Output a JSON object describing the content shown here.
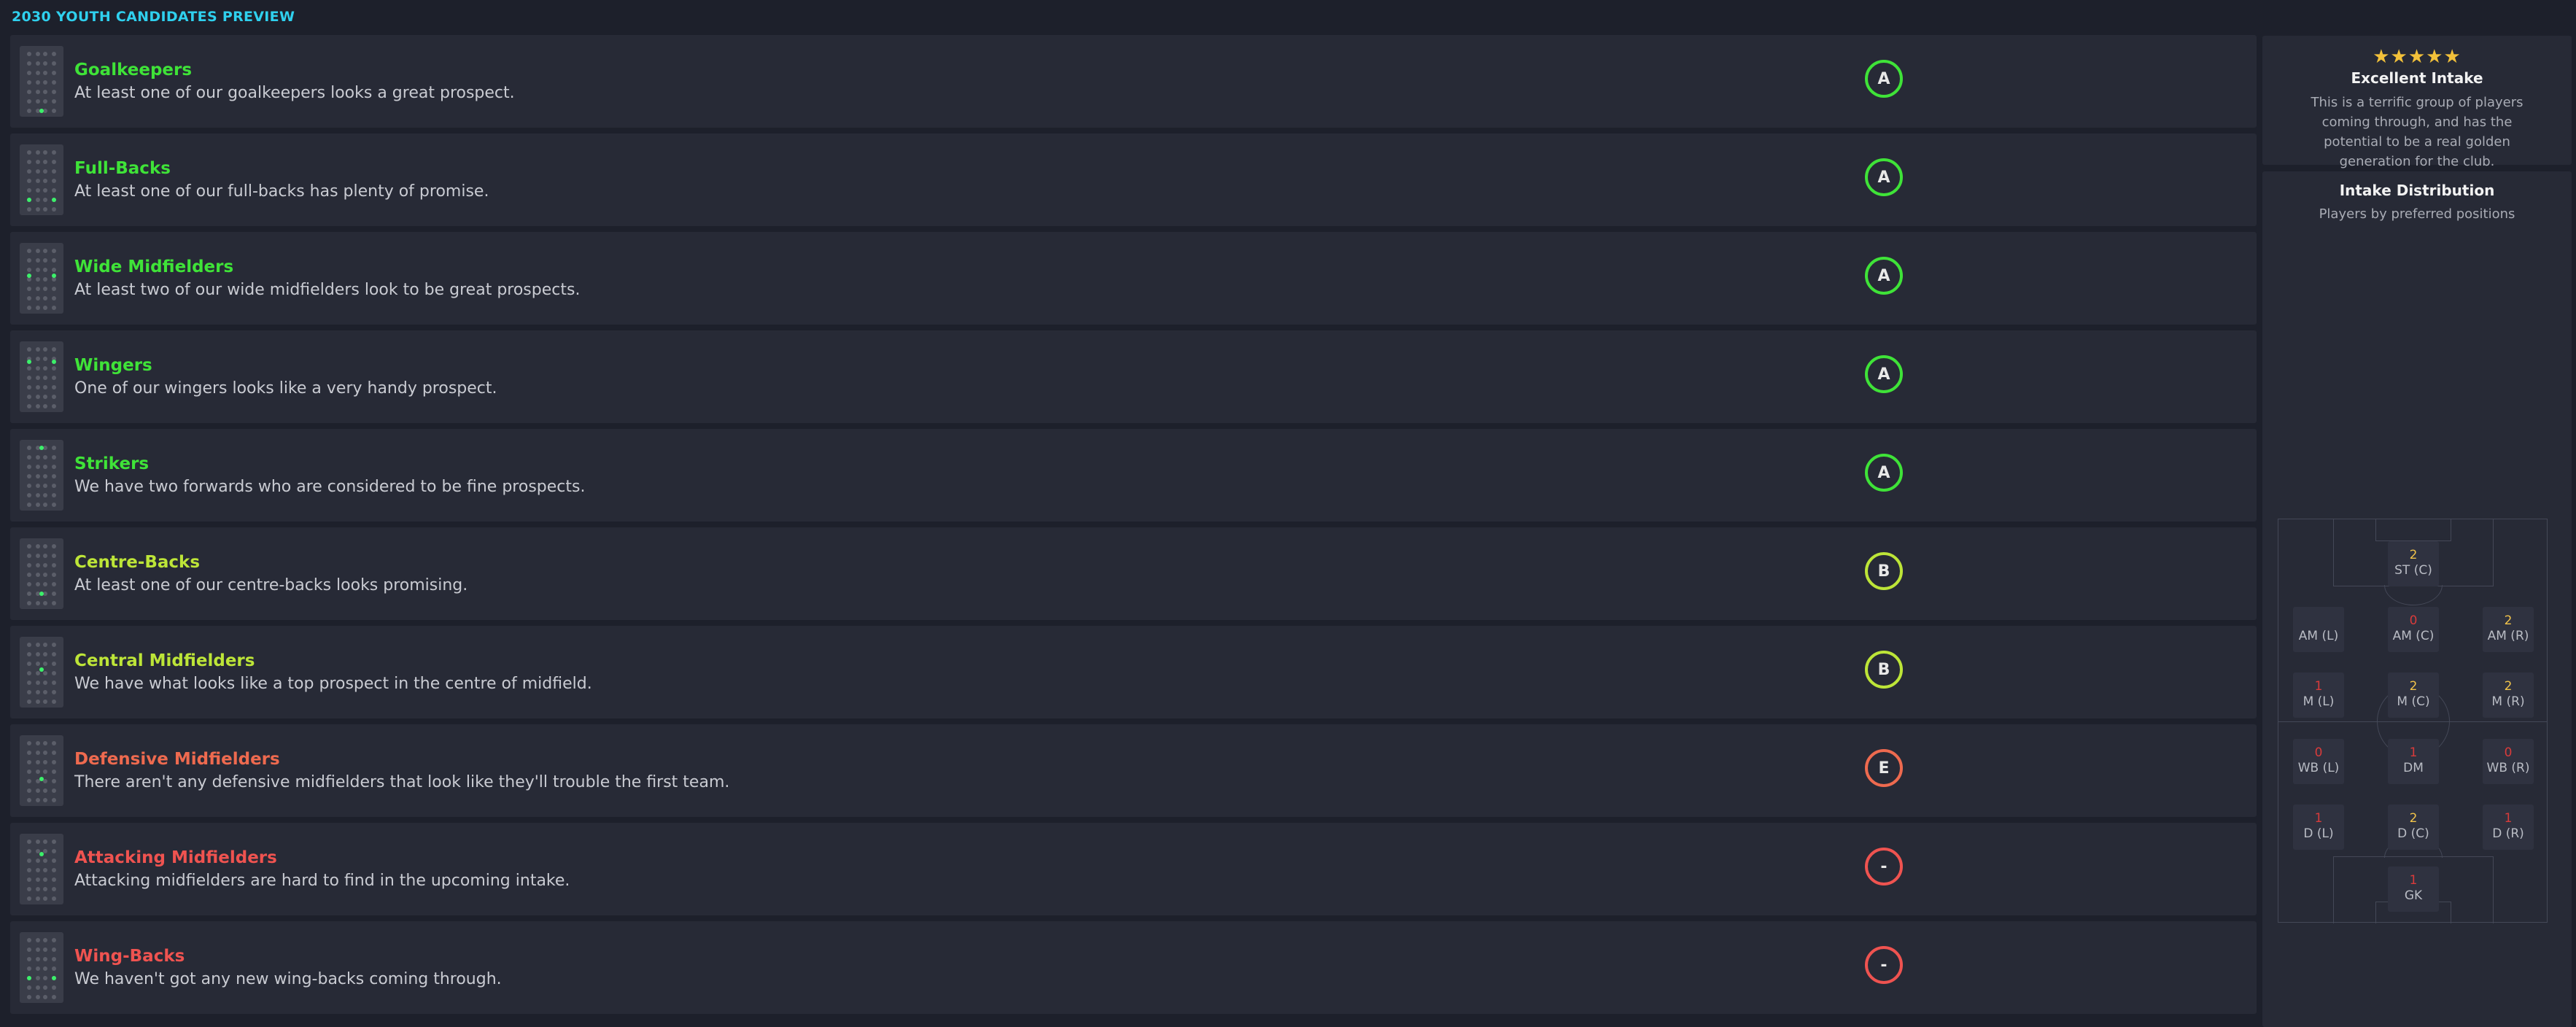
{
  "page": {
    "title": "2030 YOUTH CANDIDATES PREVIEW"
  },
  "colors": {
    "A": "#3fe338",
    "B": "#bde538",
    "E": "#ee6a4f",
    "dash": "#ef5350",
    "star": "#f3c13a",
    "pos_count_good": "#f1c34a",
    "pos_count_bad": "#d83b3b"
  },
  "rows": [
    {
      "title": "Goalkeepers",
      "desc": "At least one of our goalkeepers looks a great prospect.",
      "grade": "A",
      "icon": "position-gk-icon"
    },
    {
      "title": "Full-Backs",
      "desc": "At least one of our full-backs has plenty of promise.",
      "grade": "A",
      "icon": "position-fb-icon"
    },
    {
      "title": "Wide Midfielders",
      "desc": "At least two of our wide midfielders look to be great prospects.",
      "grade": "A",
      "icon": "position-wm-icon"
    },
    {
      "title": "Wingers",
      "desc": "One of our wingers looks like a very handy prospect.",
      "grade": "A",
      "icon": "position-w-icon"
    },
    {
      "title": "Strikers",
      "desc": "We have two forwards who are considered to be fine prospects.",
      "grade": "A",
      "icon": "position-st-icon"
    },
    {
      "title": "Centre-Backs",
      "desc": "At least one of our centre-backs looks promising.",
      "grade": "B",
      "icon": "position-cb-icon"
    },
    {
      "title": "Central Midfielders",
      "desc": "We have what looks like a top prospect in the centre of midfield.",
      "grade": "B",
      "icon": "position-cm-icon"
    },
    {
      "title": "Defensive Midfielders",
      "desc": "There aren't any defensive midfielders that look like they'll trouble the first team.",
      "grade": "E",
      "icon": "position-dm-icon"
    },
    {
      "title": "Attacking Midfielders",
      "desc": "Attacking midfielders are hard to find in the upcoming intake.",
      "grade": "-",
      "icon": "position-am-icon"
    },
    {
      "title": "Wing-Backs",
      "desc": "We haven't got any new wing-backs coming through.",
      "grade": "-",
      "icon": "position-wb-icon"
    }
  ],
  "intake": {
    "stars": "★★★★★",
    "rating_out_of_5": 5,
    "title": "Excellent Intake",
    "desc": "This is a terrific group of players coming through, and has the potential to be a real golden generation for the club."
  },
  "distribution": {
    "title": "Intake Distribution",
    "subtitle": "Players by preferred positions",
    "positions": [
      {
        "key": "st_c",
        "label": "ST (C)",
        "count": "2"
      },
      {
        "key": "am_l",
        "label": "AM (L)",
        "count": ""
      },
      {
        "key": "am_c",
        "label": "AM (C)",
        "count": "0"
      },
      {
        "key": "am_r",
        "label": "AM (R)",
        "count": "2"
      },
      {
        "key": "m_l",
        "label": "M (L)",
        "count": "1"
      },
      {
        "key": "m_c",
        "label": "M (C)",
        "count": "2"
      },
      {
        "key": "m_r",
        "label": "M (R)",
        "count": "2"
      },
      {
        "key": "wb_l",
        "label": "WB (L)",
        "count": "0"
      },
      {
        "key": "dm",
        "label": "DM",
        "count": "1"
      },
      {
        "key": "wb_r",
        "label": "WB (R)",
        "count": "0"
      },
      {
        "key": "d_l",
        "label": "D (L)",
        "count": "1"
      },
      {
        "key": "d_c",
        "label": "D (C)",
        "count": "2"
      },
      {
        "key": "d_r",
        "label": "D (R)",
        "count": "1"
      },
      {
        "key": "gk",
        "label": "GK",
        "count": "1"
      }
    ]
  }
}
